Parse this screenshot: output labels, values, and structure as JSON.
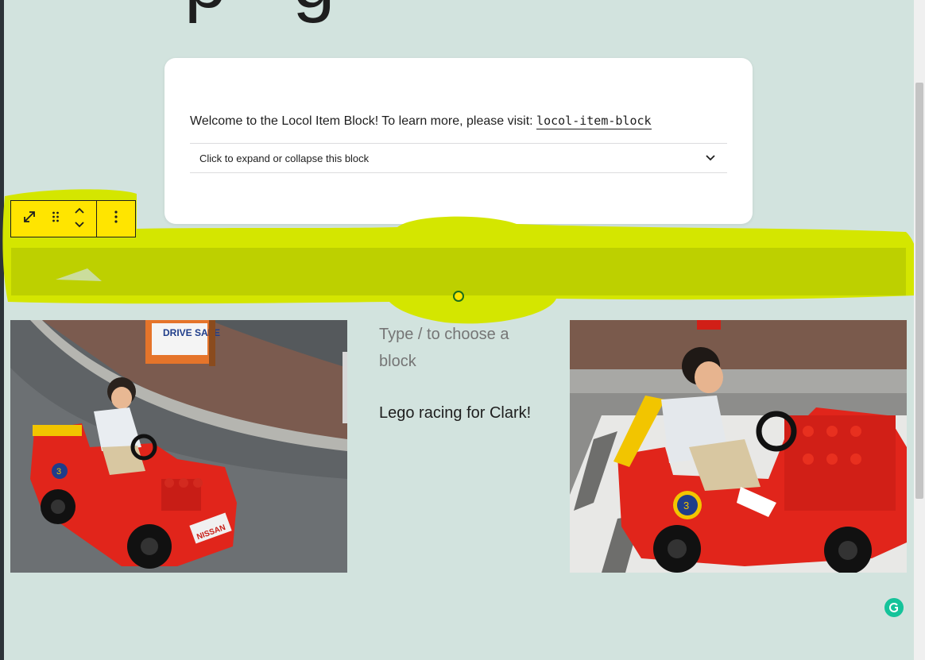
{
  "page": {
    "title_fragment": "p    g"
  },
  "card": {
    "intro_text": "Welcome to the Locol Item Block! To learn more, please visit: ",
    "link_text": "locol-item-block",
    "expander_label": "Click to expand or collapse this block"
  },
  "toolbar": {
    "icons": [
      "expand-icon",
      "drag-handle-icon",
      "move-up-icon",
      "move-down-icon",
      "more-options-icon"
    ]
  },
  "editor": {
    "placeholder": "Type / to choose a block",
    "caption": "Lego racing for Clark!"
  },
  "colors": {
    "background": "#d2e3de",
    "highlight": "#d4e600",
    "toolbar": "#ffe500",
    "grammarly": "#15c39a"
  }
}
